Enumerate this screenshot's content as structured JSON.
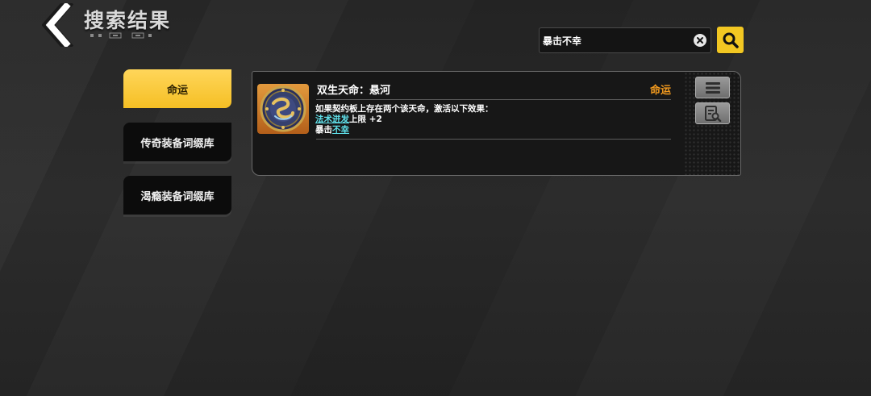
{
  "header": {
    "title": "搜索结果",
    "back_icon": "chevron-left-icon"
  },
  "search": {
    "value": "暴击不幸",
    "clear_icon": "close-circle-icon",
    "search_icon": "magnifier-icon"
  },
  "sidebar": {
    "items": [
      {
        "label": "命运",
        "active": true
      },
      {
        "label": "传奇装备词缀库",
        "active": false
      },
      {
        "label": "渴瘾装备词缀库",
        "active": false
      }
    ]
  },
  "result": {
    "name": "双生天命：悬河",
    "category": "命运",
    "description": {
      "intro": "如果契约板上存在两个该天命，激活以下效果：",
      "line1_keyword": "法术迸发",
      "line1_rest": "上限 +2",
      "line2_prefix": "暴击",
      "line2_keyword": "不幸"
    },
    "icons": {
      "item": "swirl-medallion-icon",
      "list": "list-icon",
      "detail": "document-search-icon"
    }
  },
  "colors": {
    "accent_yellow": "#f5bf24",
    "category_orange": "#f29a1e",
    "keyword_cyan": "#5fe0ea"
  }
}
